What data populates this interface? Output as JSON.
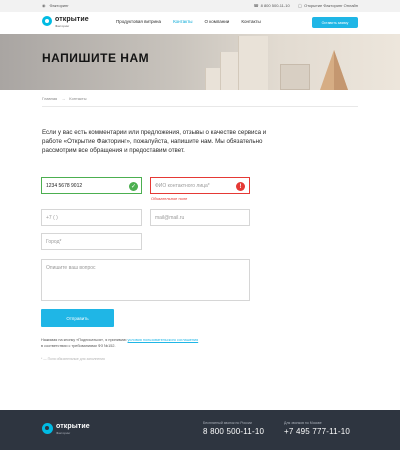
{
  "topbar": {
    "left_label": "Факторинг",
    "phone": "8 800 500-11-10",
    "online_label": "Открытие Факторинг Онлайн"
  },
  "header": {
    "logo_name": "открытие",
    "logo_sub": "Факторинг",
    "nav": [
      "Продуктовая витрина",
      "Контакты",
      "О компании",
      "Контакты"
    ],
    "cta_label": "Оставить заявку"
  },
  "hero": {
    "title": "НАПИШИТЕ НАМ"
  },
  "breadcrumb": {
    "home": "Главная",
    "sep": "→",
    "current": "Контакты"
  },
  "intro": {
    "text": "Если у вас есть комментарии или предложения, отзывы о качестве сервиса и работе «Открытие Факторинг», пожалуйста, напишите нам. Мы обязательно рассмотрим все обращения и предоставим ответ."
  },
  "form": {
    "phone_filled_value": "1234 5678 9012",
    "fio_placeholder": "ФИО контактного лица*",
    "fio_error": "Обязательное поле",
    "phone_placeholder": "+7 (   )",
    "email_placeholder": "mail@mail.ru",
    "city_placeholder": "Город*",
    "message_placeholder": "Опишите ваш вопрос",
    "submit_label": "Отправить"
  },
  "consent": {
    "prefix": "Нажимая на кнопку «Подписаться», я принимаю",
    "link": "условия пользовательского соглашения",
    "suffix": "в соответствии с требованиями ФЗ №152.",
    "footnote": "* — Поля обязательные для заполнения"
  },
  "footer": {
    "logo_name": "открытие",
    "logo_sub": "Факторинг",
    "phone1_label": "Бесплатный звонок по России",
    "phone1": "8 800 500-11-10",
    "phone2_label": "Для звонков по Москве",
    "phone2": "+7 495 777-11-10"
  },
  "colors": {
    "accent": "#1fb6e6",
    "success": "#4caf50",
    "error": "#e53935",
    "footer_bg": "#2e3540"
  }
}
